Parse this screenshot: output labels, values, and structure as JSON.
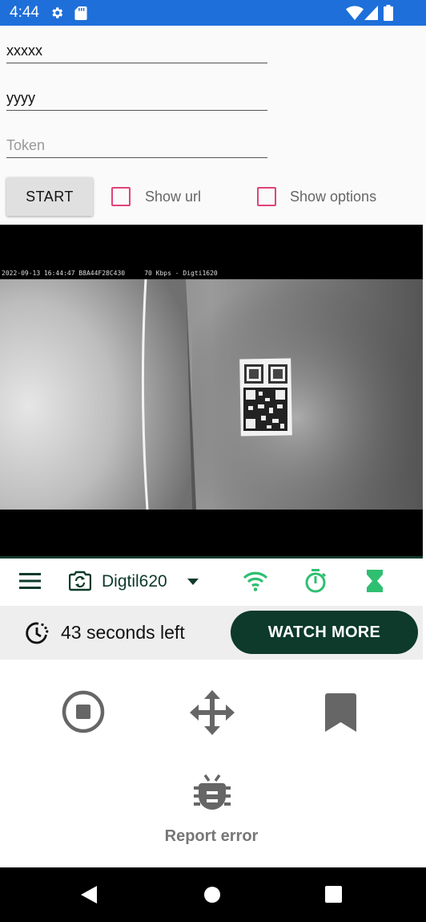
{
  "status_bar": {
    "time": "4:44",
    "icons": [
      "gear-icon",
      "sd-card-icon",
      "wifi-icon",
      "signal-icon",
      "battery-icon"
    ]
  },
  "form": {
    "username_value": "xxxxx",
    "password_value": "yyyy",
    "token_placeholder": "Token",
    "start_label": "START",
    "show_url_label": "Show url",
    "show_options_label": "Show options",
    "show_url_checked": false,
    "show_options_checked": false
  },
  "video": {
    "osd_text": "2022-09-13 16:44:47 B8A44F28C430     70 Kbps - Digti1620"
  },
  "toolbar": {
    "camera_name": "Digtil620",
    "icons": [
      "menu-icon",
      "camera-switch-icon",
      "dropdown-arrow-icon",
      "wifi-icon",
      "stopwatch-icon",
      "hourglass-icon"
    ]
  },
  "timer": {
    "time_left_text": "43 seconds left",
    "watch_more_label": "WATCH MORE"
  },
  "actions": {
    "icons": [
      "stop-icon",
      "move-icon",
      "bookmark-icon",
      "bug-icon"
    ],
    "report_error_label": "Report error"
  },
  "colors": {
    "status_bar": "#1e6fd9",
    "accent_dark_green": "#0d3a2a",
    "green_icons": "#2fbf71",
    "checkbox_pink": "#e0437a"
  }
}
